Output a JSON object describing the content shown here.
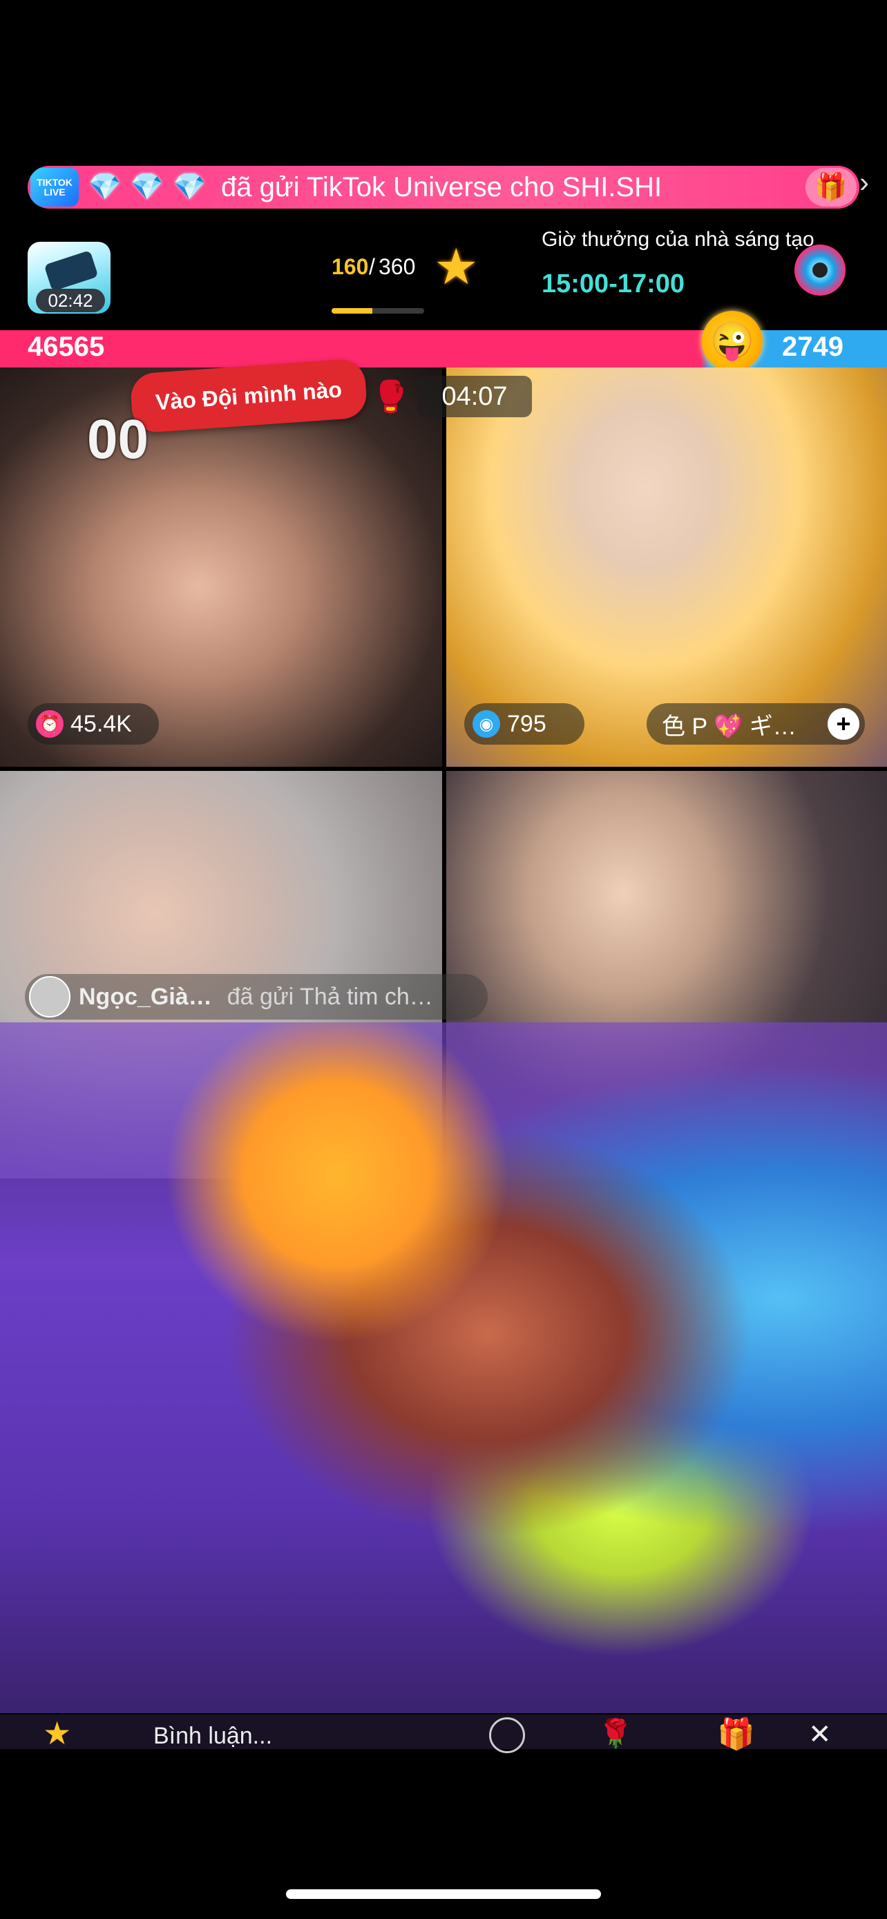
{
  "banner": {
    "badge_text": "TIKTOK LIVE",
    "gems": [
      "💎",
      "💎",
      "💎"
    ],
    "message": "đã gửi TikTok Universe cho SHI.SHI",
    "gift_icon": "🎁",
    "chevron": "›"
  },
  "status": {
    "live_timer": "02:42",
    "progress_current": "160",
    "progress_slash": "/",
    "progress_target": "360",
    "progress_fraction": 0.44,
    "star_icon": "★",
    "reward_title": "Giờ thưởng của nhà sáng tạo",
    "reward_time": "15:00-17:00"
  },
  "battle": {
    "score_left": "46565",
    "score_right": "2749",
    "mascot": "😜",
    "timer": "04:07",
    "icon": "🥊"
  },
  "tiles": {
    "team_bubble": "Vào Đội mình nào",
    "mic_mark": "00",
    "chip_1": {
      "icon": "⏰",
      "value": "45.4K"
    },
    "chip_2": {
      "icon": "◉",
      "value": "795"
    },
    "guest_label": "色 P 💖 ギ…",
    "guest_plus": "+"
  },
  "comment": {
    "user": "Ngọc_Già…",
    "text": "đã gửi Thả tim ch…"
  },
  "bottom": {
    "star": "★",
    "input_placeholder": "Bình luận...",
    "rose": "🌹",
    "gift": "🎁",
    "close": "✕"
  },
  "colors": {
    "red_team": "#ff2a6d",
    "blue_team": "#2fa9f0",
    "accent_gold": "#ffc526",
    "reward_teal": "#43e0d6"
  }
}
